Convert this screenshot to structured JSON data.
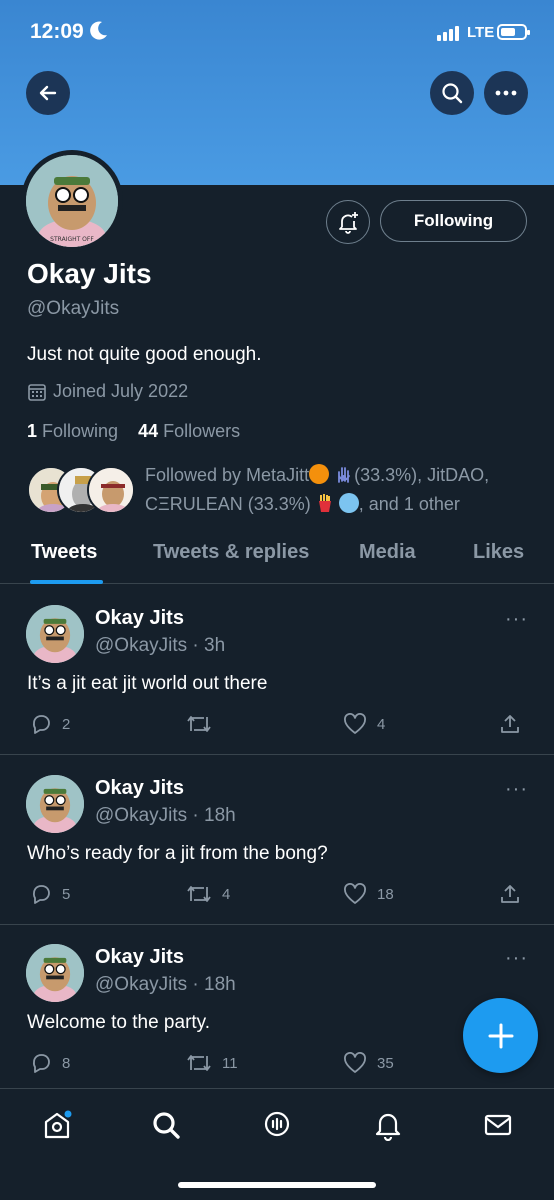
{
  "status_bar": {
    "time": "12:09",
    "network": "LTE"
  },
  "profile": {
    "name": "Okay Jits",
    "handle": "@OkayJits",
    "bio": "Just not quite good enough.",
    "joined": "Joined July 2022",
    "following_count": "1",
    "following_label": "Following",
    "followers_count": "44",
    "followers_label": "Followers",
    "follow_button_label": "Following",
    "followed_by": {
      "prefix": "Followed by MetaJitt",
      "part2": "(33.3%), JitDAO,",
      "part3": "CΞRULEAN (33.3%)",
      "suffix": ", and 1 other"
    }
  },
  "tabs": [
    "Tweets",
    "Tweets & replies",
    "Media",
    "Likes"
  ],
  "tweets": [
    {
      "name": "Okay Jits",
      "handle_time": "@OkayJits · 3h",
      "text": "It’s a jit eat jit world out there",
      "replies": "2",
      "retweets": "",
      "likes": "4"
    },
    {
      "name": "Okay Jits",
      "handle_time": "@OkayJits · 18h",
      "text": "Who’s ready for a jit from the bong?",
      "replies": "5",
      "retweets": "4",
      "likes": "18"
    },
    {
      "name": "Okay Jits",
      "handle_time": "@OkayJits · 18h",
      "text": "Welcome to the party.",
      "replies": "8",
      "retweets": "11",
      "likes": "35"
    }
  ],
  "icons": {
    "back": "back-arrow-icon",
    "search": "search-icon",
    "more": "more-icon",
    "bell": "notification-bell-icon",
    "calendar": "calendar-icon",
    "reply": "reply-icon",
    "retweet": "retweet-icon",
    "like": "heart-icon",
    "share": "share-icon",
    "compose": "compose-plus-icon",
    "home": "home-icon",
    "explore": "search-icon",
    "spaces": "spaces-icon",
    "notifications": "bell-icon",
    "messages": "mail-icon"
  },
  "colors": {
    "accent": "#1d9bf0",
    "background": "#15202b",
    "banner": "#4a9be3",
    "muted": "#8b98a5"
  }
}
